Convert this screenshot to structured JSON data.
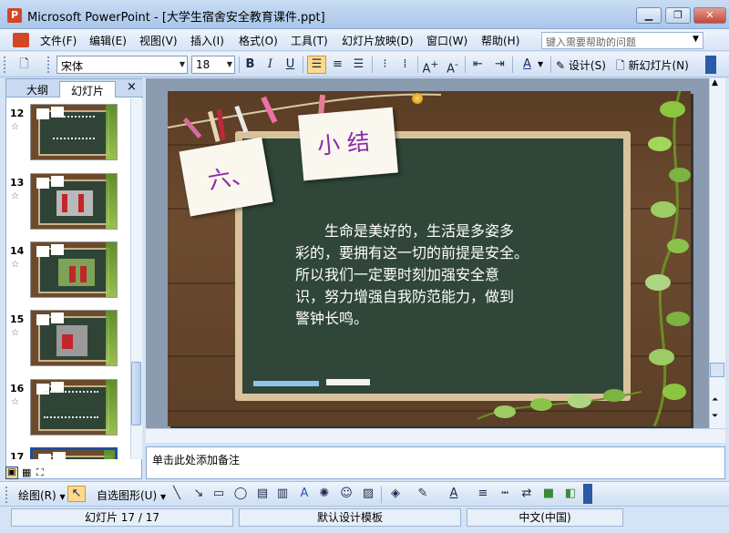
{
  "window": {
    "title": "Microsoft PowerPoint - [大学生宿舍安全教育课件.ppt]",
    "app_icon": "powerpoint-icon",
    "controls": [
      "minimize-icon",
      "maximize-icon",
      "close-icon"
    ]
  },
  "menu": {
    "items": [
      "文件(F)",
      "编辑(E)",
      "视图(V)",
      "插入(I)",
      "格式(O)",
      "工具(T)",
      "幻灯片放映(D)",
      "窗口(W)",
      "帮助(H)"
    ],
    "help_placeholder": "键入需要帮助的问题"
  },
  "toolbar": {
    "font_name": "宋体",
    "font_size": "18",
    "bold": "B",
    "italic": "I",
    "underline": "U",
    "design_label": "设计(S)",
    "new_slide_label": "新幻灯片(N)"
  },
  "left_pane": {
    "tab_outline": "大纲",
    "tab_slides": "幻灯片",
    "close": "×",
    "slides": [
      {
        "number": "12",
        "variant": "text"
      },
      {
        "number": "13",
        "variant": "photo"
      },
      {
        "number": "14",
        "variant": "photo-green"
      },
      {
        "number": "15",
        "variant": "photo-red"
      },
      {
        "number": "16",
        "variant": "text"
      },
      {
        "number": "17",
        "variant": "selected"
      }
    ],
    "star": "☆"
  },
  "slide": {
    "card_left": "六、",
    "card_right": "小 结",
    "body_lines": [
      "　　生命是美好的，生活是多姿多",
      "彩的，要拥有这一切的前提是安全。",
      "所以我们一定要时刻加强安全意",
      "识，努力增强自我防范能力，做到",
      "警钟长鸣。"
    ]
  },
  "notes": {
    "placeholder": "单击此处添加备注"
  },
  "drawbar": {
    "draw_label": "绘图(R)",
    "autoshape_label": "自选图形(U)"
  },
  "status": {
    "slide_info": "幻灯片 17 / 17",
    "template": "默认设计模板",
    "language": "中文(中国)"
  },
  "colors": {
    "card_text": "#8a2aa8",
    "board": "#2f4638",
    "accent_highlight": "#fcd98f"
  }
}
